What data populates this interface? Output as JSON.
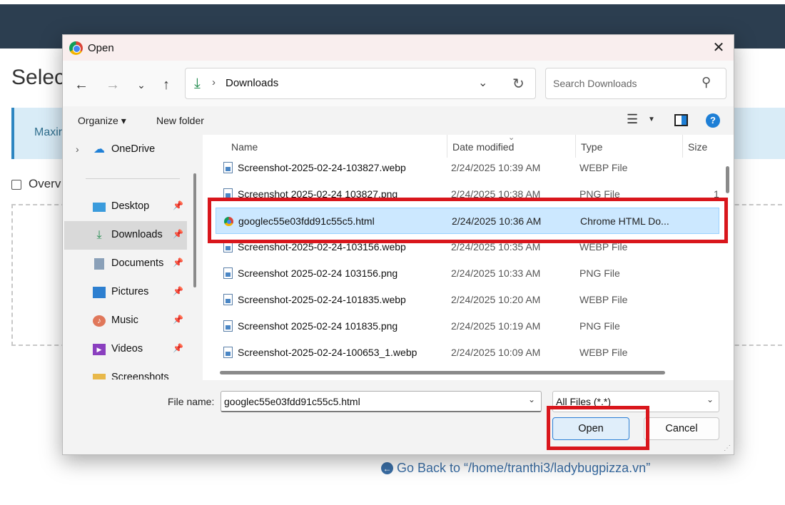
{
  "background": {
    "title": "Selec",
    "alert_text": "Maxir",
    "overwrite_label": "Overv",
    "back_link": "Go Back to “/home/tranthi3/ladybugpizza.vn”"
  },
  "dialog": {
    "title": "Open",
    "address": {
      "path": "Downloads"
    },
    "search_placeholder": "Search Downloads",
    "toolbar": {
      "organize": "Organize ▾",
      "new_folder": "New folder"
    },
    "sidebar": [
      {
        "label": "OneDrive",
        "icon": "cloud-icon",
        "pinned": false
      },
      {
        "label": "Desktop",
        "icon": "desktop-icon",
        "pinned": true
      },
      {
        "label": "Downloads",
        "icon": "download-icon",
        "pinned": true,
        "active": true
      },
      {
        "label": "Documents",
        "icon": "document-icon",
        "pinned": true
      },
      {
        "label": "Pictures",
        "icon": "picture-icon",
        "pinned": true
      },
      {
        "label": "Music",
        "icon": "music-icon",
        "pinned": true
      },
      {
        "label": "Videos",
        "icon": "video-icon",
        "pinned": true
      },
      {
        "label": "Screenshots",
        "icon": "folder-icon",
        "pinned": false
      }
    ],
    "columns": {
      "name": "Name",
      "date": "Date modified",
      "type": "Type",
      "size": "Size"
    },
    "files": [
      {
        "name": "Screenshot-2025-02-24-103827.webp",
        "date": "2/24/2025 10:39 AM",
        "type": "WEBP File",
        "size": ""
      },
      {
        "name": "Screenshot 2025-02-24 103827.png",
        "date": "2/24/2025 10:38 AM",
        "type": "PNG File",
        "size": "1"
      },
      {
        "name": "googlec55e03fdd91c55c5.html",
        "date": "2/24/2025 10:36 AM",
        "type": "Chrome HTML Do...",
        "size": "",
        "selected": true
      },
      {
        "name": "Screenshot-2025-02-24-103156.webp",
        "date": "2/24/2025 10:35 AM",
        "type": "WEBP File",
        "size": ""
      },
      {
        "name": "Screenshot 2025-02-24 103156.png",
        "date": "2/24/2025 10:33 AM",
        "type": "PNG File",
        "size": ""
      },
      {
        "name": "Screenshot-2025-02-24-101835.webp",
        "date": "2/24/2025 10:20 AM",
        "type": "WEBP File",
        "size": ""
      },
      {
        "name": "Screenshot 2025-02-24 101835.png",
        "date": "2/24/2025 10:19 AM",
        "type": "PNG File",
        "size": ""
      },
      {
        "name": "Screenshot-2025-02-24-100653_1.webp",
        "date": "2/24/2025 10:09 AM",
        "type": "WEBP File",
        "size": ""
      }
    ],
    "file_name_label": "File name:",
    "file_name_value": "googlec55e03fdd91c55c5.html",
    "filter_value": "All Files (*.*)",
    "open_label": "Open",
    "cancel_label": "Cancel"
  },
  "colors": {
    "highlight": "#d9161c",
    "selection": "#cce8ff",
    "accent": "#2b7fd6"
  }
}
